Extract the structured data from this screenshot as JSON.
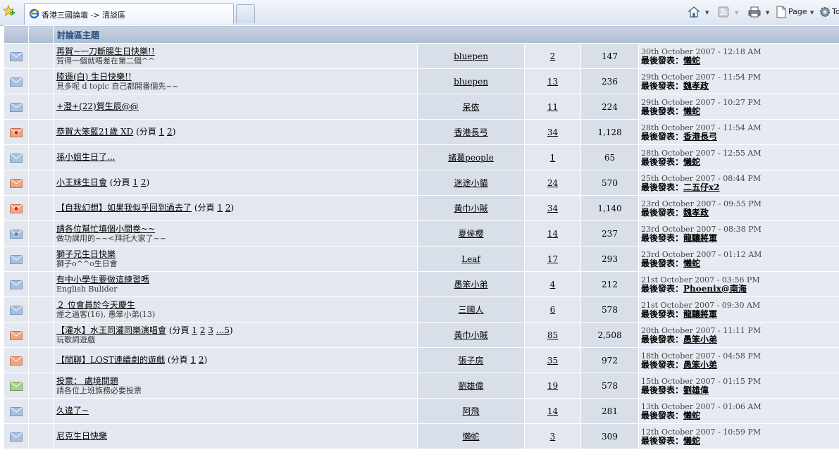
{
  "browser": {
    "tab_title": "香港三國論壇 -> 清談區",
    "page_menu_label": "Page",
    "tools_menu_label": "To"
  },
  "colors": {
    "envelope_normal": "#a8c0de",
    "envelope_hot": "#f0a37f",
    "envelope_poll": "#a9d08c",
    "header_text": "#2b4d7e"
  },
  "table": {
    "header_title": "討論區主題"
  },
  "topics": [
    {
      "icon": "envelope-icon",
      "icon_type": "normal",
      "title": "再賀~一刀斷腸生日快樂!!",
      "desc": "賀得一個就唔差在第二個^^",
      "pages_prefix": "",
      "pages": [],
      "pages_suffix": "",
      "author": "bluepen",
      "replies": "2",
      "views": "147",
      "last_date": "30th October 2007 - 12:18 AM",
      "last_label": "最後發表：",
      "last_user": "懶蛇"
    },
    {
      "icon": "envelope-icon",
      "icon_type": "normal",
      "title": "陸遜(白) 生日快樂!!",
      "desc": "見多呢 d topic 自己都開番個先~~",
      "pages_prefix": "",
      "pages": [],
      "pages_suffix": "",
      "author": "bluepen",
      "replies": "13",
      "views": "236",
      "last_date": "29th October 2007 - 11:54 PM",
      "last_label": "最後發表：",
      "last_user": "魏孝政"
    },
    {
      "icon": "envelope-icon",
      "icon_type": "normal",
      "title": "+澄+(22)賀生辰@@",
      "desc": "",
      "pages_prefix": "",
      "pages": [],
      "pages_suffix": "",
      "author": "呆依",
      "replies": "11",
      "views": "224",
      "last_date": "29th October 2007 - 10:27 PM",
      "last_label": "最後發表：",
      "last_user": "懶蛇"
    },
    {
      "icon": "hot-topic-envelope-icon",
      "icon_type": "hot-dot",
      "title": "恭賀大笨藍21歲 XD",
      "desc": "",
      "pages_prefix": "(分頁 ",
      "pages": [
        "1",
        "2"
      ],
      "pages_suffix": ")",
      "author": "香港長弓",
      "replies": "34",
      "views": "1,128",
      "last_date": "28th October 2007 - 11:54 AM",
      "last_label": "最後發表：",
      "last_user": "香港長弓"
    },
    {
      "icon": "envelope-icon",
      "icon_type": "normal",
      "title": "孫小姐生日了...",
      "desc": "",
      "pages_prefix": "",
      "pages": [],
      "pages_suffix": "",
      "author": "諸葛people",
      "replies": "1",
      "views": "65",
      "last_date": "28th October 2007 - 12:55 AM",
      "last_label": "最後發表：",
      "last_user": "懶蛇"
    },
    {
      "icon": "hot-topic-envelope-icon",
      "icon_type": "hot",
      "title": "小王妹生日會",
      "desc": "",
      "pages_prefix": "(分頁 ",
      "pages": [
        "1",
        "2"
      ],
      "pages_suffix": ")",
      "author": "迷途小貓",
      "replies": "24",
      "views": "570",
      "last_date": "25th October 2007 - 08:44 PM",
      "last_label": "最後發表：",
      "last_user": "二五仔x2"
    },
    {
      "icon": "hot-topic-envelope-icon",
      "icon_type": "hot-dot",
      "title": "【自我幻想】如果我似乎回到過去了",
      "desc": "",
      "pages_prefix": "(分頁 ",
      "pages": [
        "1",
        "2"
      ],
      "pages_suffix": ")",
      "author": "黃巾小賊",
      "replies": "34",
      "views": "1,140",
      "last_date": "23rd October 2007 - 09:55 PM",
      "last_label": "最後發表：",
      "last_user": "魏孝政"
    },
    {
      "icon": "envelope-icon",
      "icon_type": "normal-dot",
      "title": "請各位幫忙填個小問卷~~",
      "desc": "做功課用的~~<拜託大家了~~",
      "pages_prefix": "",
      "pages": [],
      "pages_suffix": "",
      "author": "夏侯櫻",
      "replies": "14",
      "views": "237",
      "last_date": "23rd October 2007 - 08:38 PM",
      "last_label": "最後發表：",
      "last_user": "龍驤將軍"
    },
    {
      "icon": "envelope-icon",
      "icon_type": "normal",
      "title": "獅子兄生日快樂",
      "desc": "獅子o^^o生日會",
      "pages_prefix": "",
      "pages": [],
      "pages_suffix": "",
      "author": "Leaf",
      "replies": "17",
      "views": "293",
      "last_date": "23rd October 2007 - 01:12 AM",
      "last_label": "最後發表：",
      "last_user": "懶蛇"
    },
    {
      "icon": "envelope-icon",
      "icon_type": "normal",
      "title": "有中小學生要做這練習嗎",
      "desc": "English Bulider",
      "pages_prefix": "",
      "pages": [],
      "pages_suffix": "",
      "author": "愚笨小弟",
      "replies": "4",
      "views": "212",
      "last_date": "21st October 2007 - 03:56 PM",
      "last_label": "最後發表：",
      "last_user": "Phoenix@南海"
    },
    {
      "icon": "envelope-icon",
      "icon_type": "normal",
      "title": "２ 位會員於今天慶生",
      "desc": "煙之過客(16), 愚笨小弟(13)",
      "pages_prefix": "",
      "pages": [],
      "pages_suffix": "",
      "author": "三國人",
      "replies": "6",
      "views": "578",
      "last_date": "21st October 2007 - 09:30 AM",
      "last_label": "最後發表：",
      "last_user": "龍驤將軍"
    },
    {
      "icon": "hot-topic-envelope-icon",
      "icon_type": "hot",
      "title": "【灌水】水王同灌同樂演唱會",
      "desc": "玩歌詞遊戲",
      "pages_prefix": "(分頁 ",
      "pages": [
        "1",
        "2",
        "3",
        "...5"
      ],
      "pages_suffix": ")",
      "author": "黃巾小賊",
      "replies": "85",
      "views": "2,508",
      "last_date": "20th October 2007 - 11:11 PM",
      "last_label": "最後發表：",
      "last_user": "愚笨小弟"
    },
    {
      "icon": "hot-topic-envelope-icon",
      "icon_type": "hot",
      "title": "【閒聊】LOST連續劇的遊戲",
      "desc": "",
      "pages_prefix": "(分頁 ",
      "pages": [
        "1",
        "2"
      ],
      "pages_suffix": ")",
      "author": "張子房",
      "replies": "35",
      "views": "972",
      "last_date": "18th October 2007 - 04:58 PM",
      "last_label": "最後發表：",
      "last_user": "愚笨小弟"
    },
    {
      "icon": "poll-envelope-icon",
      "icon_type": "poll",
      "title": "投票： 處境問題",
      "desc": "請各位上班族務必要投票",
      "pages_prefix": "",
      "pages": [],
      "pages_suffix": "",
      "author": "劉雄偉",
      "replies": "19",
      "views": "578",
      "last_date": "15th October 2007 - 01:15 PM",
      "last_label": "最後發表：",
      "last_user": "劉雄偉"
    },
    {
      "icon": "envelope-icon",
      "icon_type": "normal",
      "title": "久違了~",
      "desc": "",
      "pages_prefix": "",
      "pages": [],
      "pages_suffix": "",
      "author": "阿飛",
      "replies": "14",
      "views": "281",
      "last_date": "13th October 2007 - 01:06 AM",
      "last_label": "最後發表：",
      "last_user": "懶蛇"
    },
    {
      "icon": "envelope-icon",
      "icon_type": "normal",
      "title": "尼克生日快樂",
      "desc": "",
      "pages_prefix": "",
      "pages": [],
      "pages_suffix": "",
      "author": "懶蛇",
      "replies": "3",
      "views": "309",
      "last_date": "12th October 2007 - 10:59 PM",
      "last_label": "最後發表：",
      "last_user": "懶蛇"
    }
  ]
}
